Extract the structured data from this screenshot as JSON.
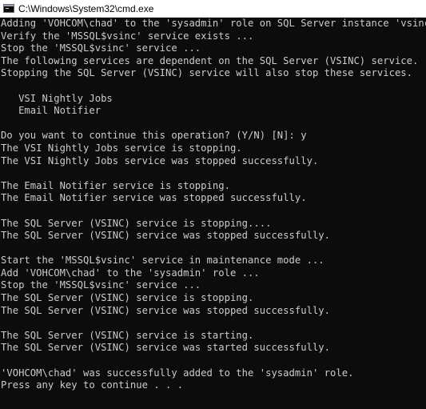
{
  "window": {
    "title": "C:\\Windows\\System32\\cmd.exe",
    "icon": "cmd-icon"
  },
  "console": {
    "lines": [
      "Adding 'VOHCOM\\chad' to the 'sysadmin' role on SQL Server instance 'vsinc'",
      "Verify the 'MSSQL$vsinc' service exists ...",
      "Stop the 'MSSQL$vsinc' service ...",
      "The following services are dependent on the SQL Server (VSINC) service.",
      "Stopping the SQL Server (VSINC) service will also stop these services.",
      "",
      "   VSI Nightly Jobs",
      "   Email Notifier",
      "",
      "Do you want to continue this operation? (Y/N) [N]: y",
      "The VSI Nightly Jobs service is stopping.",
      "The VSI Nightly Jobs service was stopped successfully.",
      "",
      "The Email Notifier service is stopping.",
      "The Email Notifier service was stopped successfully.",
      "",
      "The SQL Server (VSINC) service is stopping....",
      "The SQL Server (VSINC) service was stopped successfully.",
      "",
      "Start the 'MSSQL$vsinc' service in maintenance mode ...",
      "Add 'VOHCOM\\chad' to the 'sysadmin' role ...",
      "Stop the 'MSSQL$vsinc' service ...",
      "The SQL Server (VSINC) service is stopping.",
      "The SQL Server (VSINC) service was stopped successfully.",
      "",
      "The SQL Server (VSINC) service is starting.",
      "The SQL Server (VSINC) service was started successfully.",
      "",
      "'VOHCOM\\chad' was successfully added to the 'sysadmin' role.",
      "Press any key to continue . . ."
    ]
  },
  "colors": {
    "background": "#0c0c0c",
    "foreground": "#cccccc",
    "titlebar": "#ffffff"
  }
}
